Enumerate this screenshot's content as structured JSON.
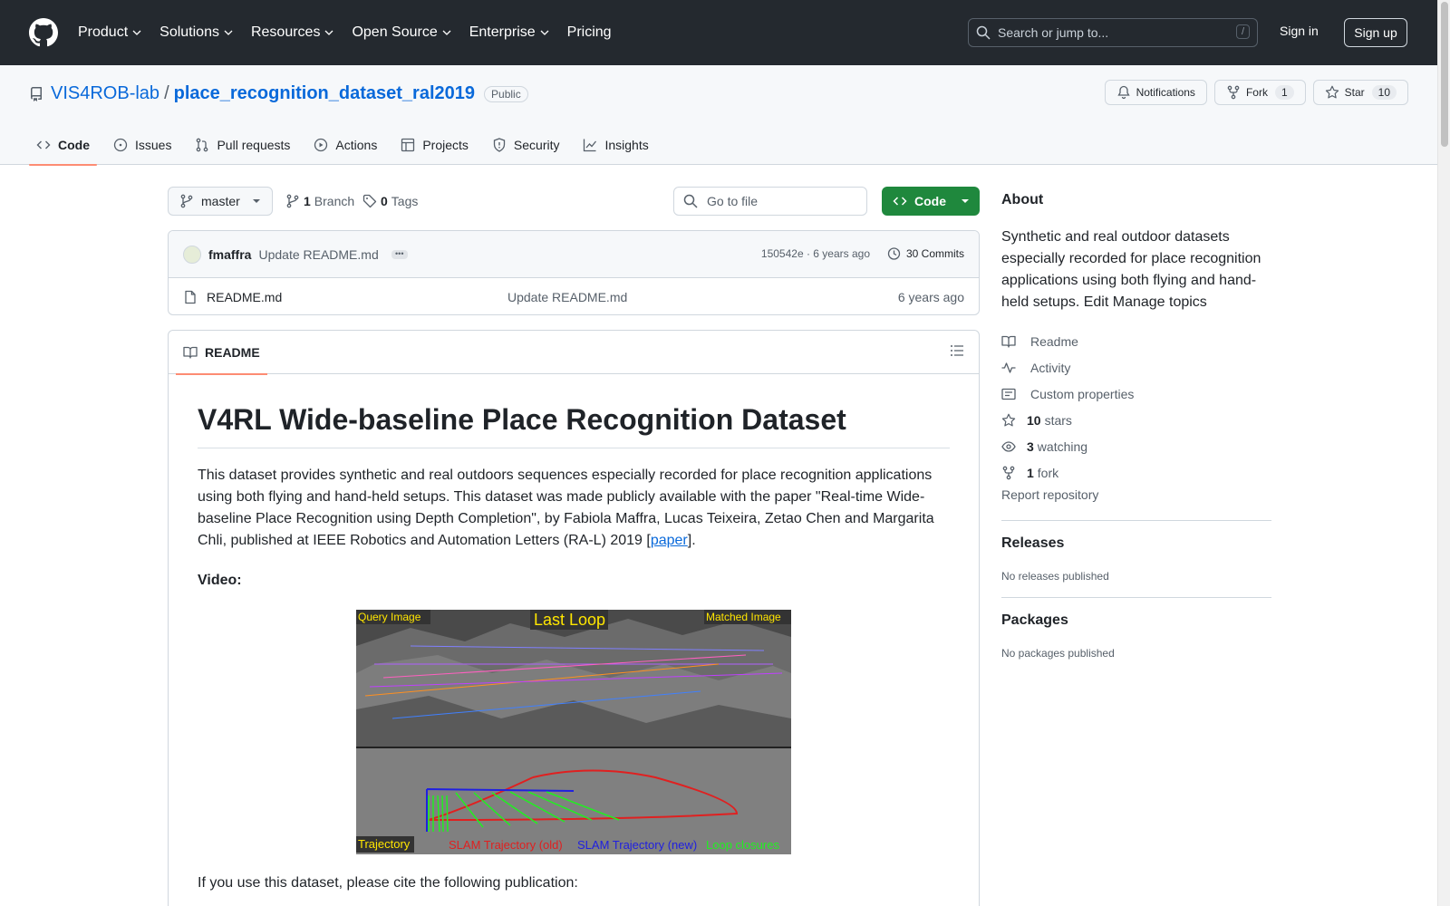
{
  "header": {
    "nav": [
      "Product",
      "Solutions",
      "Resources",
      "Open Source",
      "Enterprise",
      "Pricing"
    ],
    "search_placeholder": "Search or jump to...",
    "search_shortcut": "/",
    "sign_in": "Sign in",
    "sign_up": "Sign up"
  },
  "repo": {
    "owner": "VIS4ROB-lab",
    "separator": "/",
    "name": "place_recognition_dataset_ral2019",
    "visibility": "Public",
    "notifications_label": "Notifications",
    "fork_label": "Fork",
    "fork_count": "1",
    "star_label": "Star",
    "star_count": "10"
  },
  "tabs": [
    "Code",
    "Issues",
    "Pull requests",
    "Actions",
    "Projects",
    "Security",
    "Insights"
  ],
  "toolbar": {
    "branch": "master",
    "branch_count": "1",
    "branch_label": "Branch",
    "tag_count": "0",
    "tag_label": "Tags",
    "goto_placeholder": "Go to file",
    "code_label": "Code"
  },
  "commit": {
    "author": "fmaffra",
    "message": "Update README.md",
    "dots": "•••",
    "meta": "150542e · 6 years ago",
    "commits_label": "30 Commits"
  },
  "files": [
    {
      "name": "README.md",
      "message": "Update README.md",
      "age": "6 years ago"
    }
  ],
  "readme": {
    "tab_label": "README",
    "title": "V4RL Wide-baseline Place Recognition Dataset",
    "intro": "This dataset provides synthetic and real outdoors sequences especially recorded for place recognition applications using both flying and hand-held setups. This dataset was made publicly available with the paper \"Real-time Wide-baseline Place Recognition using Depth Completion\", by Fabiola Maffra, Lucas Teixeira, Zetao Chen and Margarita Chli, published at IEEE Robotics and Automation Letters (RA-L) 2019 [",
    "paper_link": "paper",
    "intro_end": "].",
    "video_label": "Video:",
    "video": {
      "query": "Query Image",
      "last_loop": "Last Loop",
      "matched": "Matched Image",
      "trajectory": "Trajectory",
      "slam_old": "SLAM Trajectory (old)",
      "slam_new": "SLAM Trajectory (new)",
      "loop_closures": "Loop closures"
    },
    "cite": "If you use this dataset, please cite the following publication:"
  },
  "sidebar": {
    "about_title": "About",
    "description": "Synthetic and real outdoor datasets especially recorded for place recognition applications using both flying and hand-held setups. Edit Manage topics",
    "items": [
      {
        "icon": "book-icon",
        "strong": "",
        "label": "Readme"
      },
      {
        "icon": "pulse-icon",
        "strong": "",
        "label": "Activity"
      },
      {
        "icon": "note-icon",
        "strong": "",
        "label": "Custom properties"
      },
      {
        "icon": "star-icon",
        "strong": "10",
        "label": "stars"
      },
      {
        "icon": "eye-icon",
        "strong": "3",
        "label": "watching"
      },
      {
        "icon": "fork-icon",
        "strong": "1",
        "label": "fork"
      }
    ],
    "report": "Report repository",
    "releases_title": "Releases",
    "releases_text": "No releases published",
    "packages_title": "Packages",
    "packages_text": "No packages published"
  },
  "colors": {
    "header_bg": "#24292f",
    "accent": "#0969da",
    "code_button": "#1f883d",
    "tab_underline": "#fd8c73"
  }
}
